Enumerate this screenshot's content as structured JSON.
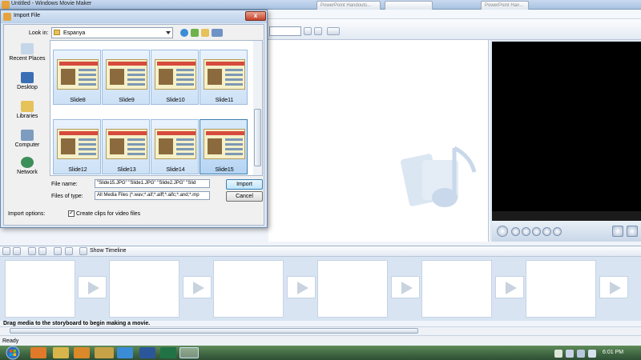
{
  "window": {
    "title": "Untitled - Windows Movie Maker"
  },
  "background_tabs": [
    "PowerPoint Handouts...",
    "",
    "PowerPoint Han..."
  ],
  "toolbar": {
    "combo_value": ""
  },
  "storyboard": {
    "show_timeline_label": "Show Timeline",
    "drag_message": "Drag media to the storyboard to begin making a movie."
  },
  "statusbar": {
    "text": "Ready"
  },
  "taskbar": {
    "clock": "6:01 PM"
  },
  "dialog": {
    "title": "Import File",
    "close_label": "x",
    "look_in_label": "Look in:",
    "look_in_value": "Espanya",
    "places": [
      "Recent Places",
      "Desktop",
      "Libraries",
      "Computer",
      "Network"
    ],
    "files": [
      {
        "name": "Slide8"
      },
      {
        "name": "Slide9"
      },
      {
        "name": "Slide10"
      },
      {
        "name": "Slide11"
      },
      {
        "name": "Slide12"
      },
      {
        "name": "Slide13"
      },
      {
        "name": "Slide14"
      },
      {
        "name": "Slide15"
      }
    ],
    "file_name_label": "File name:",
    "file_name_value": "\"Slide15.JPG\" \"Slide1.JPG\" \"Slide2.JPG\" \"Slid",
    "files_of_type_label": "Files of type:",
    "files_of_type_value": "All Media Files (*.wav;*.aif;*.aiff;*.aifc;*.and;*.mp",
    "import_button": "Import",
    "cancel_button": "Cancel",
    "import_options_label": "Import options:",
    "create_clips_label": "Create clips for video files",
    "create_clips_checked": true
  },
  "colors": {
    "accent": "#3c7fb1",
    "taskbar": "#3e6541"
  }
}
